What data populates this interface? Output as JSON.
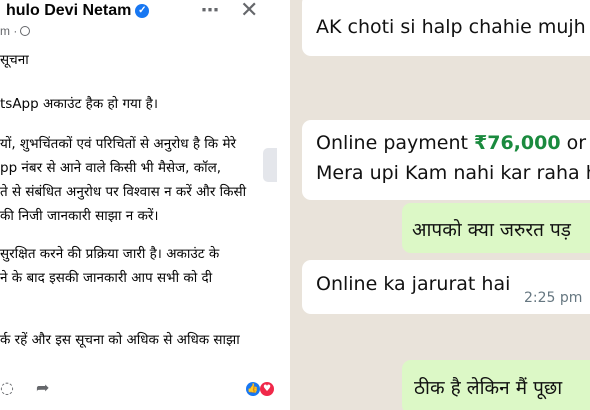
{
  "facebook_post": {
    "author_name": "hulo Devi Netam",
    "meta": "m ·",
    "more_icon": "⋯",
    "close_icon": "✕",
    "lines": [
      "सूचना",
      "tsApp अकाउंट हैक हो गया है।",
      "यों, शुभचिंतकों एवं परिचितों से अनुरोध है कि मेरे",
      "pp नंबर से आने वाले किसी भी मैसेज, कॉल,",
      "ते से संबंधित अनुरोध पर विश्वास न करें और किसी",
      "की निजी जानकारी साझा न करें।",
      "सुरक्षित करने की प्रक्रिया जारी है। अकाउंट के",
      "ने के बाद इसकी जानकारी आप सभी को दी",
      "",
      "र्क रहें और इस सूचना को अधिक से अधिक साझा"
    ],
    "reaction_icons": [
      "like-icon",
      "heart-icon"
    ]
  },
  "whatsapp_chat": {
    "messages": [
      {
        "direction": "incoming",
        "text": "AK choti si halp chahie mujh"
      },
      {
        "direction": "incoming",
        "text_before": "Online payment ",
        "amount": "₹76,000",
        "text_after": " or",
        "line2": "Mera upi Kam nahi kar raha h"
      },
      {
        "direction": "outgoing",
        "text": "आपको क्या जरुरत पड़"
      },
      {
        "direction": "incoming",
        "text": "Online ka jarurat hai",
        "time": "2:25 pm"
      },
      {
        "direction": "outgoing",
        "text": "ठीक है लेकिन मैं पूछा"
      }
    ],
    "colors": {
      "background": "#e9e3da",
      "incoming": "#ffffff",
      "outgoing": "#dcf8c6",
      "amount": "#1a8a3e"
    }
  }
}
